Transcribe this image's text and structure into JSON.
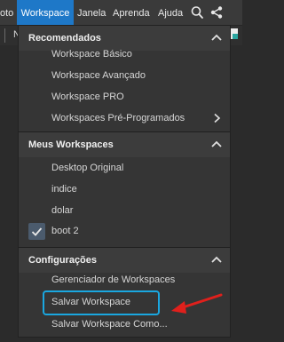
{
  "menubar": {
    "items": [
      "oto",
      "Workspace",
      "Janela",
      "Aprenda",
      "Ajuda"
    ],
    "active_index": 1,
    "icons": [
      "search-icon",
      "share-icon"
    ]
  },
  "toolbar": {
    "mark": "N"
  },
  "dropdown": {
    "sections": [
      {
        "title": "Recomendados",
        "icon": "chevron-up-icon",
        "items": [
          {
            "label": "Workspace Básico"
          },
          {
            "label": "Workspace Avançado"
          },
          {
            "label": "Workspace PRO"
          },
          {
            "label": "Workspaces Pré-Programados",
            "has_submenu": true
          }
        ]
      },
      {
        "title": "Meus Workspaces",
        "icon": "chevron-up-icon",
        "items": [
          {
            "label": "Desktop Original"
          },
          {
            "label": "indice"
          },
          {
            "label": "dolar"
          },
          {
            "label": "boot 2",
            "checked": true
          }
        ]
      },
      {
        "title": "Configurações",
        "icon": "chevron-up-icon",
        "items": [
          {
            "label": "Gerenciador de Workspaces"
          },
          {
            "label": "Salvar Workspace",
            "highlighted": true
          },
          {
            "label": "Salvar Workspace Como..."
          }
        ]
      }
    ]
  },
  "colors": {
    "menubar_bg": "#3a3a3a",
    "active_menu": "#1e78c8",
    "dropdown_bg": "#353535",
    "section_bg": "#3c3c3c",
    "highlight_border": "#1aa7e0",
    "annotation_arrow": "#e0201c"
  }
}
